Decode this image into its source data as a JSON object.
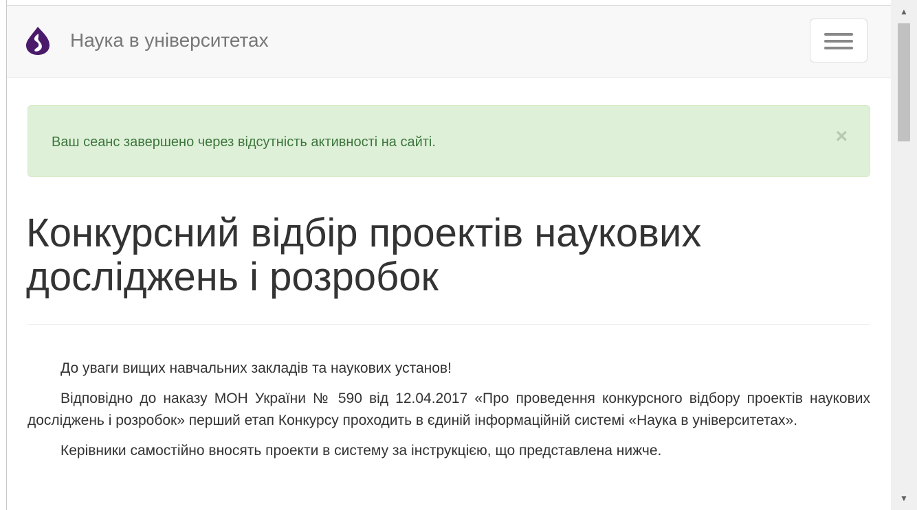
{
  "navbar": {
    "brand_name": "Наука в університетах",
    "logo_icon": "droplet-logo-icon",
    "menu_icon": "hamburger-menu-icon"
  },
  "alert": {
    "message": "Ваш сеанс завершено через відсутність активності на сайті.",
    "close_label": "×"
  },
  "page": {
    "title_line1": "Конкурсний відбір проектів наукових",
    "title_line2": "досліджень і розробок",
    "paragraphs": [
      "До уваги вищих навчальних закладів та наукових установ!",
      "Відповідно до наказу МОН України № 590 від 12.04.2017 «Про проведення конкурсного відбору проектів наукових досліджень і розробок» перший етап Конкурсу проходить в єдиній інформаційній системі «Наука в університетах».",
      "Керівники самостійно вносять проекти в систему за інструкцією, що представлена нижче."
    ]
  },
  "scrollbar": {
    "up_label": "▲",
    "down_label": "▼"
  },
  "colors": {
    "logo": "#4a1a6b",
    "alert_bg": "#dff0d8",
    "alert_text": "#3c763d",
    "navbar_bg": "#f8f8f8"
  }
}
